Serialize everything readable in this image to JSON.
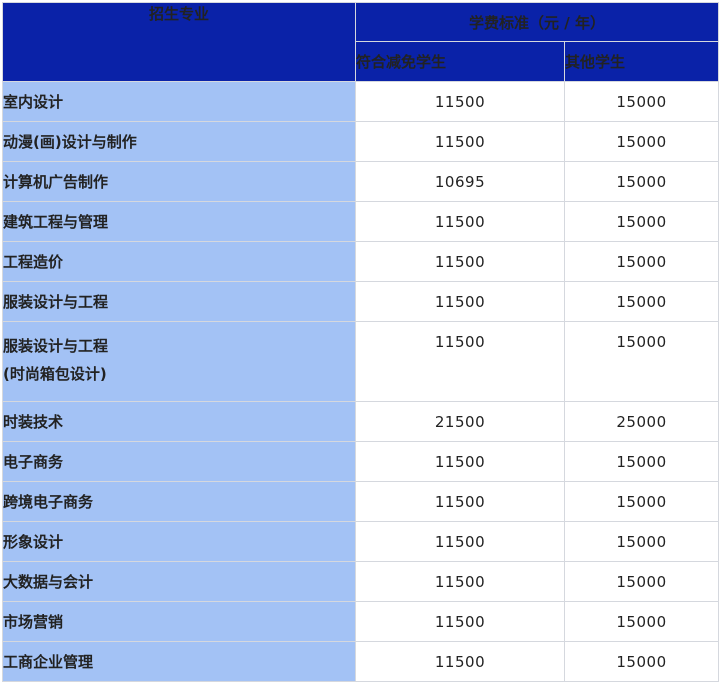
{
  "header": {
    "major_label": "招生专业",
    "tuition_label": "学费标准（元 / 年）",
    "eligible_label": "符合减免学生",
    "other_label": "其他学生"
  },
  "rows": [
    {
      "major": "室内设计",
      "eligible": "11500",
      "other": "15000"
    },
    {
      "major": "动漫(画)设计与制作",
      "eligible": "11500",
      "other": "15000"
    },
    {
      "major": "计算机广告制作",
      "eligible": "10695",
      "other": "15000"
    },
    {
      "major": "建筑工程与管理",
      "eligible": "11500",
      "other": "15000"
    },
    {
      "major": "工程造价",
      "eligible": "11500",
      "other": "15000"
    },
    {
      "major": "服装设计与工程",
      "eligible": "11500",
      "other": "15000"
    },
    {
      "major_lines": [
        "服装设计与工程",
        "(时尚箱包设计)"
      ],
      "eligible": "11500",
      "other": "15000"
    },
    {
      "major": "时装技术",
      "eligible": "21500",
      "other": "25000"
    },
    {
      "major": "电子商务",
      "eligible": "11500",
      "other": "15000"
    },
    {
      "major": "跨境电子商务",
      "eligible": "11500",
      "other": "15000"
    },
    {
      "major": "形象设计",
      "eligible": "11500",
      "other": "15000"
    },
    {
      "major": "大数据与会计",
      "eligible": "11500",
      "other": "15000"
    },
    {
      "major": "市场营销",
      "eligible": "11500",
      "other": "15000"
    },
    {
      "major": "工商企业管理",
      "eligible": "11500",
      "other": "15000"
    }
  ],
  "colors": {
    "header_bg": "#0a22a8",
    "major_bg": "#a3c2f5",
    "fee_bg": "#ffffff",
    "border": "#d5d8de"
  }
}
